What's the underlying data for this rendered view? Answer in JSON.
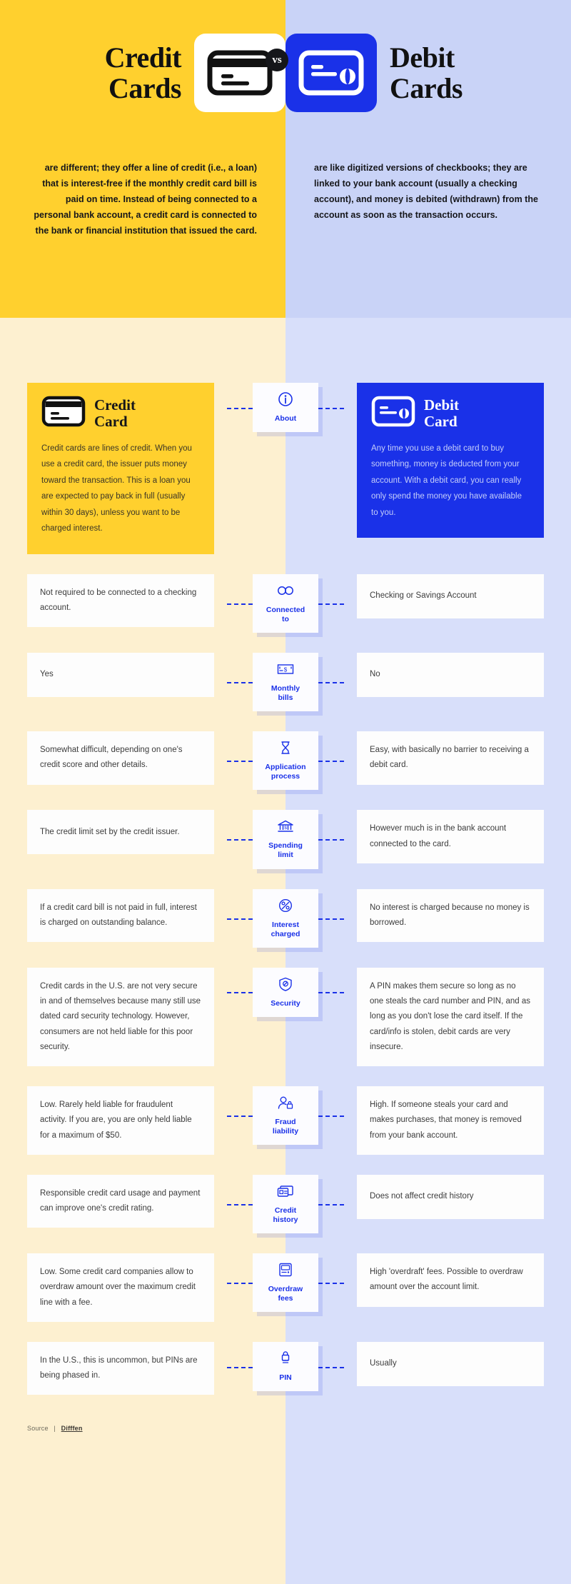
{
  "hero": {
    "left_title": "Credit\nCards",
    "right_title": "Debit\nCards",
    "vs": "vs",
    "left_icon": "credit-card-icon",
    "right_icon": "debit-card-icon",
    "left_body": "are different; they offer a line of credit (i.e., a loan) that is interest-free if the monthly credit card bill is paid on time. Instead of being connected to a personal bank account, a credit card is connected to the bank or financial institution that issued the card.",
    "right_body": "are like digitized versions of checkbooks; they are linked to your bank account (usually a checking account), and money is debited (withdrawn) from the account as soon as the transaction occurs."
  },
  "colors": {
    "yellow": "#FFD02E",
    "yellow_light": "#FDF0D0",
    "blue": "#1A31E8",
    "blue_light": "#C9D3F7",
    "blue_lighter": "#D8DFFA",
    "dark": "#15161A",
    "white": "#FFFFFF"
  },
  "intro": {
    "label": "About",
    "icon": "info-circle-icon",
    "credit": {
      "name": "Credit\nCard",
      "icon": "credit-card-icon",
      "text": "Credit cards are lines of credit. When you use a credit card, the issuer puts money toward the transaction. This is a loan you are expected to pay back in full (usually within 30 days), unless you want to be charged interest."
    },
    "debit": {
      "name": "Debit\nCard",
      "icon": "debit-card-icon",
      "text": "Any time you use a debit card to buy something, money is deducted from your account. With a debit card, you can really only spend the money you have available to you."
    }
  },
  "rows": [
    {
      "label": "Connected\nto",
      "icon": "infinity-link-icon",
      "credit": "Not required to be connected to a checking account.",
      "debit": "Checking or Savings Account"
    },
    {
      "label": "Monthly\nbills",
      "icon": "cheque-icon",
      "credit": "Yes",
      "debit": "No"
    },
    {
      "label": "Application\nprocess",
      "icon": "hourglass-icon",
      "credit": "Somewhat difficult, depending on one's credit score and other details.",
      "debit": "Easy, with basically no barrier to receiving a debit card."
    },
    {
      "label": "Spending\nlimit",
      "icon": "bank-icon",
      "credit": "The credit limit set by the credit issuer.",
      "debit": "However much is in the bank account connected to the card."
    },
    {
      "label": "Interest\ncharged",
      "icon": "percent-circle-icon",
      "credit": "If a credit card bill is not paid in full, interest is charged on outstanding balance.",
      "debit": "No interest is charged because no money is borrowed."
    },
    {
      "label": "Security",
      "icon": "shield-check-icon",
      "credit": "Credit cards in the U.S. are not very secure in and of themselves because many still use dated card security technology. However, consumers are not held liable for this poor security.",
      "debit": "A PIN makes them secure so long as no one steals the card number and PIN, and as long as you don't lose the card itself. If the card/info is stolen, debit cards are very insecure."
    },
    {
      "label": "Fraud\nliability",
      "icon": "user-lock-icon",
      "credit": "Low. Rarely held liable for fraudulent activity. If you are, you are only held liable for a maximum of $50.",
      "debit": "High. If someone steals your card and makes purchases, that money is removed from your bank account."
    },
    {
      "label": "Credit\nhistory",
      "icon": "cards-stack-icon",
      "credit": "Responsible credit card usage and payment can improve one's credit rating.",
      "debit": "Does not affect credit history"
    },
    {
      "label": "Overdraw\nfees",
      "icon": "atm-screen-icon",
      "credit": "Low. Some credit card companies allow to overdraw amount over the maximum credit line with a fee.",
      "debit": "High 'overdraft' fees. Possible to overdraw amount over the account limit."
    },
    {
      "label": "PIN",
      "icon": "lock-keypad-icon",
      "credit": "In the U.S., this is uncommon, but PINs are being phased in.",
      "debit": "Usually"
    }
  ],
  "footer": {
    "source_label": "Source",
    "separator": "|",
    "source_name": "Difffen"
  }
}
